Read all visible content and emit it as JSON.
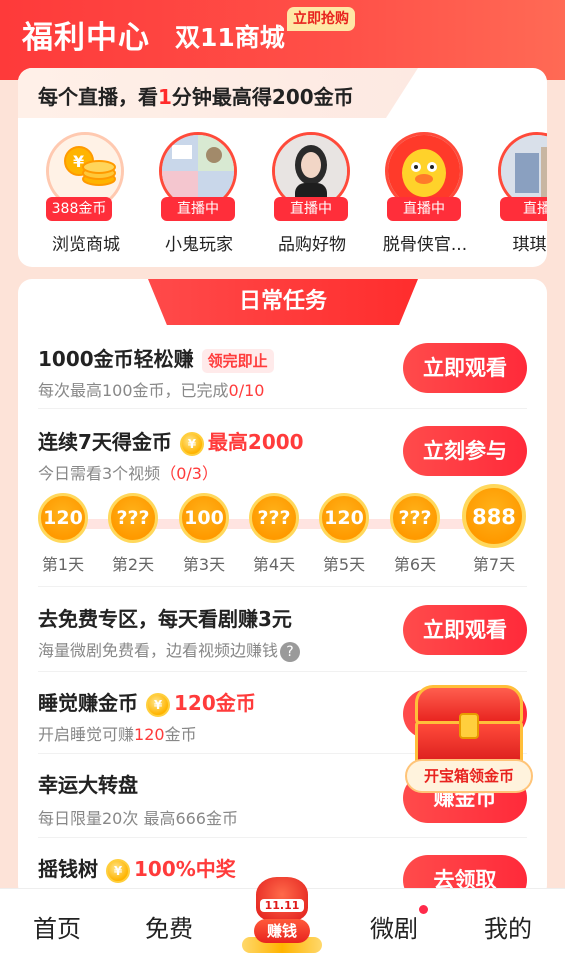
{
  "header": {
    "title": "福利中心",
    "subtitle": "双11商城",
    "badge": "立即抢购"
  },
  "live_banner": {
    "prefix": "每个直播，看",
    "highlight": "1",
    "suffix": "分钟最高得200金币"
  },
  "streams": [
    {
      "label": "浏览商城",
      "tag": "388金币",
      "icon": "coin-stack-icon"
    },
    {
      "label": "小鬼玩家",
      "tag": "直播中",
      "icon": "avatar-image"
    },
    {
      "label": "品购好物",
      "tag": "直播中",
      "icon": "avatar-image"
    },
    {
      "label": "脱骨侠官...",
      "tag": "直播中",
      "icon": "avatar-image"
    },
    {
      "label": "琪琪玩",
      "tag": "直播",
      "icon": "avatar-image"
    }
  ],
  "tasks_title": "日常任务",
  "tasks": {
    "watch": {
      "name": "1000金币轻松赚",
      "tag": "领完即止",
      "desc_prefix": "每次最高100金币，已完成",
      "desc_progress": "0/10",
      "button": "立即观看"
    },
    "streak": {
      "name": "连续7天得金币",
      "reward": "最高2000",
      "desc_prefix": "今日需看3个视频",
      "desc_progress": "（0/3）",
      "button": "立刻参与",
      "days": [
        {
          "value": "120",
          "label": "第1天"
        },
        {
          "value": "???",
          "label": "第2天"
        },
        {
          "value": "100",
          "label": "第3天"
        },
        {
          "value": "???",
          "label": "第4天"
        },
        {
          "value": "120",
          "label": "第5天"
        },
        {
          "value": "???",
          "label": "第6天"
        },
        {
          "value": "888",
          "label": "第7天"
        }
      ]
    },
    "drama": {
      "name": "去免费专区，每天看剧赚3元",
      "desc": "海量微剧免费看，边看视频边赚钱",
      "button": "立即观看"
    },
    "sleep": {
      "name": "睡觉赚金币",
      "reward": "120金币",
      "desc_prefix": "开启睡觉可赚",
      "desc_highlight": "120",
      "desc_suffix": "金币"
    },
    "wheel": {
      "name": "幸运大转盘",
      "desc": "每日限量20次 最高666金币",
      "button": "赚金币"
    },
    "tree": {
      "name": "摇钱树",
      "reward": "100%中奖",
      "button": "去领取"
    }
  },
  "chest": {
    "label": "开宝箱领金币"
  },
  "tabbar": {
    "home": "首页",
    "free": "免费",
    "earn_top": "11.11",
    "earn": "赚钱",
    "drama": "微剧",
    "mine": "我的"
  },
  "colors": {
    "accent": "#ff2e3a",
    "coin": "#ffb400",
    "background": "#fde3d8"
  }
}
